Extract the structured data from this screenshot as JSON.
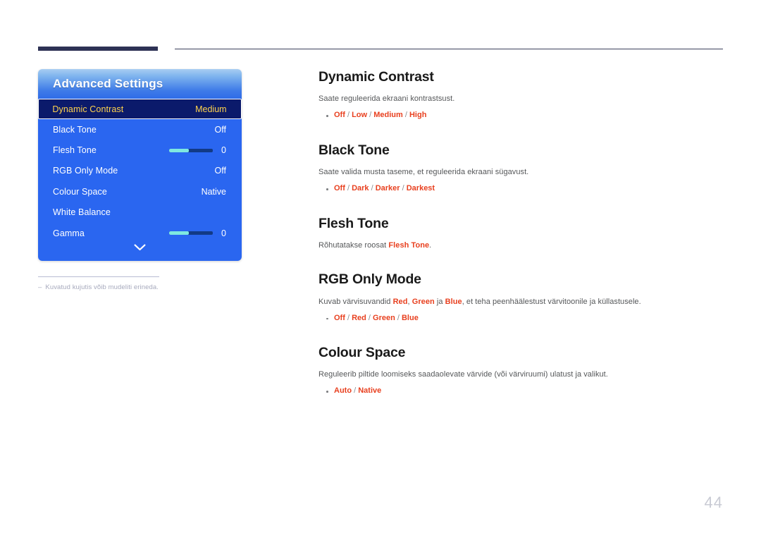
{
  "osd": {
    "title": "Advanced Settings",
    "rows": [
      {
        "label": "Dynamic Contrast",
        "value": "Medium",
        "type": "value",
        "selected": true
      },
      {
        "label": "Black Tone",
        "value": "Off",
        "type": "value",
        "selected": false
      },
      {
        "label": "Flesh Tone",
        "value": "0",
        "type": "slider",
        "selected": false
      },
      {
        "label": "RGB Only Mode",
        "value": "Off",
        "type": "value",
        "selected": false
      },
      {
        "label": "Colour Space",
        "value": "Native",
        "type": "value",
        "selected": false
      },
      {
        "label": "White Balance",
        "value": "",
        "type": "value",
        "selected": false
      },
      {
        "label": "Gamma",
        "value": "0",
        "type": "slider",
        "selected": false
      }
    ],
    "scroll_icon": "chevron-down-icon"
  },
  "footnote": {
    "dash": "–",
    "text": "Kuvatud kujutis võib mudeliti erineda."
  },
  "sections": [
    {
      "heading": "Dynamic Contrast",
      "desc_prefix": "Saate reguleerida ekraani kontrastsust.",
      "options": [
        "Off",
        "Low",
        "Medium",
        "High"
      ]
    },
    {
      "heading": "Black Tone",
      "desc_prefix": "Saate valida musta taseme, et reguleerida ekraani sügavust.",
      "options": [
        "Off",
        "Dark",
        "Darker",
        "Darkest"
      ]
    },
    {
      "heading": "Flesh Tone",
      "desc_prefix": "Rõhutatakse roosat ",
      "desc_highlight": "Flesh Tone",
      "desc_suffix": ".",
      "options": []
    },
    {
      "heading": "RGB Only Mode",
      "desc_prefix": "Kuvab värvisuvandid ",
      "desc_inline": [
        {
          "text": "Red",
          "highlight": true
        },
        {
          "text": ", ",
          "highlight": false
        },
        {
          "text": "Green",
          "highlight": true
        },
        {
          "text": " ja ",
          "highlight": false
        },
        {
          "text": "Blue",
          "highlight": true
        },
        {
          "text": ", et teha peenhäälestust värvitoonile ja küllastusele.",
          "highlight": false
        }
      ],
      "options": [
        "Off",
        "Red",
        "Green",
        "Blue"
      ]
    },
    {
      "heading": "Colour Space",
      "desc_prefix": "Reguleerib piltide loomiseks saadaolevate värvide (või värviruumi) ulatust ja valikut.",
      "options": [
        "Auto",
        "Native"
      ]
    }
  ],
  "page_number": "44",
  "colors": {
    "accent_red": "#e8401f",
    "osd_blue": "#2a66f0",
    "osd_selected_bg": "#0b1a6b",
    "osd_selected_text": "#ffd34d",
    "slider_fill": "#7fe8e0",
    "slider_track": "#123a86",
    "rule_navy": "#2e3255"
  }
}
